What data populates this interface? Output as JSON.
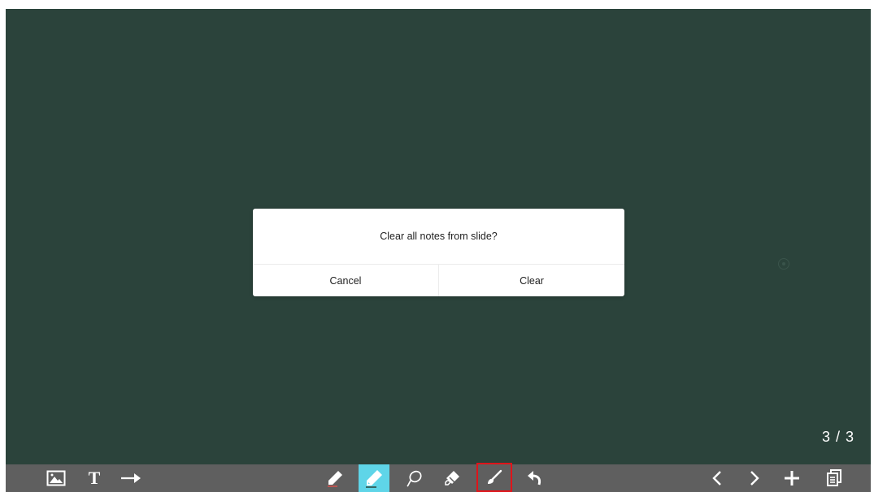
{
  "canvas": {
    "background_color": "#2b433b",
    "page_counter": "3 / 3"
  },
  "dialog": {
    "message": "Clear all notes from slide?",
    "cancel_label": "Cancel",
    "confirm_label": "Clear"
  },
  "toolbar": {
    "background_color": "#5f5f5f",
    "left_tools": [
      {
        "icon": "image-icon"
      },
      {
        "icon": "text-tool-icon",
        "glyph": "T"
      },
      {
        "icon": "arrow-tool-icon"
      }
    ],
    "center_tools": [
      {
        "icon": "pen-icon"
      },
      {
        "icon": "highlighter-icon",
        "active": true,
        "highlight_color": "#5fd5e8"
      },
      {
        "icon": "lasso-icon"
      },
      {
        "icon": "eraser-icon"
      },
      {
        "icon": "clear-brush-icon",
        "selected": true,
        "selected_border_color": "#e0141a"
      },
      {
        "icon": "undo-icon"
      }
    ],
    "right_tools": [
      {
        "icon": "previous-page-icon"
      },
      {
        "icon": "next-page-icon"
      },
      {
        "icon": "add-page-icon"
      },
      {
        "icon": "page-list-icon"
      }
    ]
  }
}
